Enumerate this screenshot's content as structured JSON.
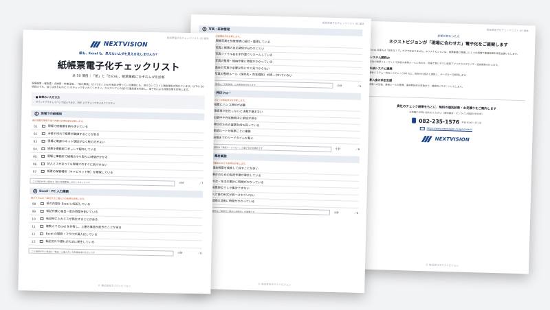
{
  "pages": [
    {
      "runhead": "紙帳票電子化チェックリスト 05 媒体",
      "logo_text": "NEXTVISION",
      "eyebrow": "紙も、Excel も、見えないムダを見える化しませんか？",
      "title": "紙帳票電子化チェックリスト",
      "subtitle": "全 50 項目｜「紙」と「Excel」、帳票業務にひそむムダを診断",
      "intro": "現場帳票・報告書・点検表・作業日報…「紙の業務」だけでなく Excel 転記が残っている業務にも、見えないコストと機会損失が隠れています。以下の 50 項目のうち、当てはまるものに ☑ のチェックを入れてください。カテゴリごとの合計で優先度を判定し、電子化による改善効果を診断します。",
      "howto_title": "■ 結果のいただき方",
      "howto_text": "プリントアウトしてペンで記入するか、PDF 上でチェックを入れてください",
      "sections": [
        {
          "number": "1",
          "title": "現場での紙運用",
          "note": "紙の帳票を現場で使う作業の日常化度を診断します。",
          "items": [
            {
              "num": "01",
              "text": "現場で紙帳票を持ち歩いている"
            },
            {
              "num": "02",
              "text": "天候や汚れで帳票が破損することがある"
            },
            {
              "num": "03",
              "text": "現場に電源やネット環境がなく紙の方がよい"
            },
            {
              "num": "04",
              "text": "帳票を複数部コピーして配布している"
            },
            {
              "num": "05",
              "text": "現場と事務所で帳票のやり取りに時間がかかる"
            },
            {
              "num": "06",
              "text": "記入ミスがあっても現場でのすぐに気づけない"
            },
            {
              "num": "07",
              "text": "帳票の保管場所（キャビネット等）を確保している"
            }
          ],
          "memo": "この項目が多い場合は「紙の現場運用」がボトルネックです",
          "subtotal_label": "小計",
          "score": "／7"
        },
        {
          "number": "2",
          "title": "Excel・PC 入力業務",
          "note": "紙から Excel へ転記する二重入力の負荷を診断します。",
          "items": [
            {
              "num": "08",
              "text": "紙の内容を Excel に転記している"
            },
            {
              "num": "09",
              "text": "転記作業に毎日一定の時間を割いている"
            },
            {
              "num": "10",
              "text": "転記時に入力ミスが発生することがある"
            },
            {
              "num": "11",
              "text": "複数人で Excel を共有し、上書き事故が起きたことがある"
            },
            {
              "num": "12",
              "text": "Excel の関数・マクロが属人化している"
            },
            {
              "num": "13",
              "text": "転記忘れや漏れがたまに発生している"
            }
          ],
          "memo": "この項目が多い場合は「転記・二重入力」の削減余地が大きいです",
          "subtotal_label": "小計",
          "score": "／6"
        }
      ],
      "footer": "© 株式会社ネクストビジョン"
    },
    {
      "runhead": "紙帳票電子化チェックリスト 05 媒体",
      "sections": [
        {
          "number": "3",
          "title": "写真・証跡管理",
          "note": "現場写真や証跡の管理状況を診断します。",
          "items": [
            {
              "num": "14",
              "text": "現場写真を別管理表に貼付・整理している"
            },
            {
              "num": "15",
              "text": "写真と帳票の対応関係が分かりにくい"
            },
            {
              "num": "16",
              "text": "写真ファイル名を手作業でリネームしている"
            },
            {
              "num": "17",
              "text": "写真の整理・格納作業に時間がかかっている"
            },
            {
              "num": "18",
              "text": "過去の写真が必要な時にすぐ見つからない"
            },
            {
              "num": "19",
              "text": "写真の整理ルール（保存先・命名規則）が統一されていない"
            }
          ],
          "memo": "この項目が多い場合は「写真整理」に改善余地があります",
          "subtotal_label": "小計",
          "score": "／6"
        },
        {
          "number": "4",
          "title": "承認・押印フロー",
          "note": "紙ベースの承認フローの滞留状況を診断します。",
          "items": [
            {
              "num": "20",
              "text": "帳票にハンコ押印が必要"
            },
            {
              "num": "21",
              "text": "承認者が出社しないと決裁が進まない"
            },
            {
              "num": "22",
              "text": "出張中や在宅勤務中に承認が滞る"
            },
            {
              "num": "23",
              "text": "押印のための書類を持ち回っている"
            },
            {
              "num": "24",
              "text": "承認ルートが帳票ごとに複雑"
            },
            {
              "num": "25",
              "text": "決裁までのリードタイムが長い"
            }
          ],
          "memo": "この項目が多い場合は「承認ワークフロー」の電子化が効果的です",
          "subtotal_label": "小計",
          "score": "／6"
        },
        {
          "number": "5",
          "title": "検索・集計業務",
          "note": "過去帳票の検索や集計にかかる負荷を診断します。",
          "items": [
            {
              "num": "26",
              "text": "過去帳票を検索して探すことが多い"
            },
            {
              "num": "27",
              "text": "集計のための転記作業が発生している"
            },
            {
              "num": "28",
              "text": "月次・年次の集計に時間がかかっている"
            },
            {
              "num": "29",
              "text": "帳票単位でしか集計できない"
            },
            {
              "num": "30",
              "text": "入力値の形式が統一されていない"
            },
            {
              "num": "31",
              "text": "記録の活用に時間がかかっている"
            }
          ],
          "memo": "この項目が多い場合は「検索性と集計の自動化」が重要です",
          "subtotal_label": "小計",
          "score": "／6"
        }
      ],
      "footer": "© 株式会社ネクストビジョン"
    },
    {
      "runhead": "紙帳票電子化チェックリスト 05 媒体",
      "eyebrow": "診断が終わったら",
      "title": "ネクストビジョンが「現場に合わせた」電子化をご提案します",
      "body": "Excel の導入は「紙をなくす」だけではありません。ネクストビジョンは、帳票業務に精通した 3 つの領域で業務改善を伴走支援いたします。",
      "blocks": [
        {
          "title": "システム開発力",
          "text": "自社の帳票フォーマットや独自の業務ルールに合わせ、現場で使いやすい帳票アプリやカスタマイズ・追加開発を行います。"
        },
        {
          "title": "外部システム連携",
          "text": "基幹システム・会計システム・CRM など、既存の仕組みと連携し、データを一元管理します。"
        },
        {
          "title": "導入後の伴走支援",
          "text": "現場への定着、業務ルールの整備、運用開始後の改善まで、継続的にサポートいたします。"
        }
      ],
      "cta_title": "貴社のチェック結果をもとに、無料の個別診断・お見積りをご案内します",
      "cta_sub": "お気軽にお問い合わせください（資料請求・オンライン相談も受付中）",
      "phone_number": "082-235-1576",
      "phone_hours": "平日 9:00〜17:30",
      "url": "https://www.nextvision.co.jp/contact/",
      "logo_text": "NEXTVISION",
      "footer": "© 株式会社ネクストビジョン"
    }
  ]
}
